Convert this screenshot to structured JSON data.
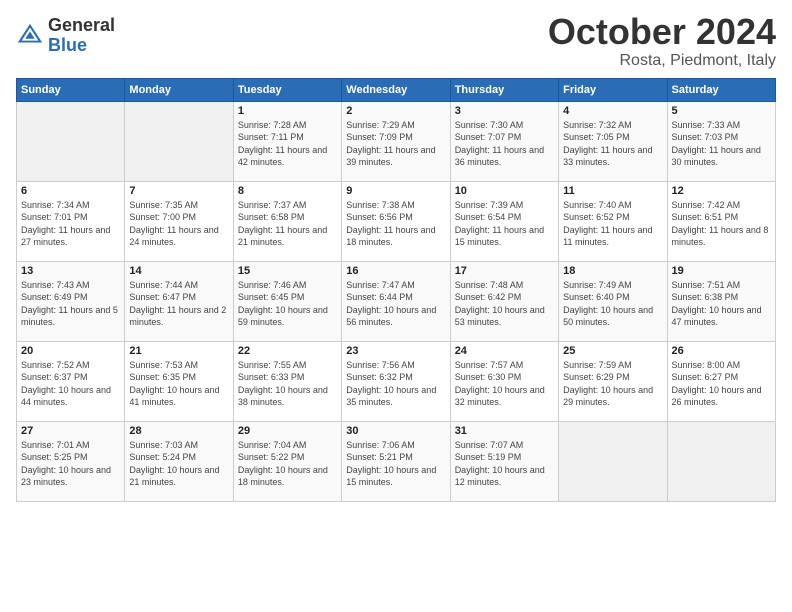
{
  "logo": {
    "general": "General",
    "blue": "Blue"
  },
  "title": "October 2024",
  "location": "Rosta, Piedmont, Italy",
  "days_of_week": [
    "Sunday",
    "Monday",
    "Tuesday",
    "Wednesday",
    "Thursday",
    "Friday",
    "Saturday"
  ],
  "weeks": [
    [
      {
        "day": "",
        "sunrise": "",
        "sunset": "",
        "daylight": ""
      },
      {
        "day": "",
        "sunrise": "",
        "sunset": "",
        "daylight": ""
      },
      {
        "day": "1",
        "sunrise": "Sunrise: 7:28 AM",
        "sunset": "Sunset: 7:11 PM",
        "daylight": "Daylight: 11 hours and 42 minutes."
      },
      {
        "day": "2",
        "sunrise": "Sunrise: 7:29 AM",
        "sunset": "Sunset: 7:09 PM",
        "daylight": "Daylight: 11 hours and 39 minutes."
      },
      {
        "day": "3",
        "sunrise": "Sunrise: 7:30 AM",
        "sunset": "Sunset: 7:07 PM",
        "daylight": "Daylight: 11 hours and 36 minutes."
      },
      {
        "day": "4",
        "sunrise": "Sunrise: 7:32 AM",
        "sunset": "Sunset: 7:05 PM",
        "daylight": "Daylight: 11 hours and 33 minutes."
      },
      {
        "day": "5",
        "sunrise": "Sunrise: 7:33 AM",
        "sunset": "Sunset: 7:03 PM",
        "daylight": "Daylight: 11 hours and 30 minutes."
      }
    ],
    [
      {
        "day": "6",
        "sunrise": "Sunrise: 7:34 AM",
        "sunset": "Sunset: 7:01 PM",
        "daylight": "Daylight: 11 hours and 27 minutes."
      },
      {
        "day": "7",
        "sunrise": "Sunrise: 7:35 AM",
        "sunset": "Sunset: 7:00 PM",
        "daylight": "Daylight: 11 hours and 24 minutes."
      },
      {
        "day": "8",
        "sunrise": "Sunrise: 7:37 AM",
        "sunset": "Sunset: 6:58 PM",
        "daylight": "Daylight: 11 hours and 21 minutes."
      },
      {
        "day": "9",
        "sunrise": "Sunrise: 7:38 AM",
        "sunset": "Sunset: 6:56 PM",
        "daylight": "Daylight: 11 hours and 18 minutes."
      },
      {
        "day": "10",
        "sunrise": "Sunrise: 7:39 AM",
        "sunset": "Sunset: 6:54 PM",
        "daylight": "Daylight: 11 hours and 15 minutes."
      },
      {
        "day": "11",
        "sunrise": "Sunrise: 7:40 AM",
        "sunset": "Sunset: 6:52 PM",
        "daylight": "Daylight: 11 hours and 11 minutes."
      },
      {
        "day": "12",
        "sunrise": "Sunrise: 7:42 AM",
        "sunset": "Sunset: 6:51 PM",
        "daylight": "Daylight: 11 hours and 8 minutes."
      }
    ],
    [
      {
        "day": "13",
        "sunrise": "Sunrise: 7:43 AM",
        "sunset": "Sunset: 6:49 PM",
        "daylight": "Daylight: 11 hours and 5 minutes."
      },
      {
        "day": "14",
        "sunrise": "Sunrise: 7:44 AM",
        "sunset": "Sunset: 6:47 PM",
        "daylight": "Daylight: 11 hours and 2 minutes."
      },
      {
        "day": "15",
        "sunrise": "Sunrise: 7:46 AM",
        "sunset": "Sunset: 6:45 PM",
        "daylight": "Daylight: 10 hours and 59 minutes."
      },
      {
        "day": "16",
        "sunrise": "Sunrise: 7:47 AM",
        "sunset": "Sunset: 6:44 PM",
        "daylight": "Daylight: 10 hours and 56 minutes."
      },
      {
        "day": "17",
        "sunrise": "Sunrise: 7:48 AM",
        "sunset": "Sunset: 6:42 PM",
        "daylight": "Daylight: 10 hours and 53 minutes."
      },
      {
        "day": "18",
        "sunrise": "Sunrise: 7:49 AM",
        "sunset": "Sunset: 6:40 PM",
        "daylight": "Daylight: 10 hours and 50 minutes."
      },
      {
        "day": "19",
        "sunrise": "Sunrise: 7:51 AM",
        "sunset": "Sunset: 6:38 PM",
        "daylight": "Daylight: 10 hours and 47 minutes."
      }
    ],
    [
      {
        "day": "20",
        "sunrise": "Sunrise: 7:52 AM",
        "sunset": "Sunset: 6:37 PM",
        "daylight": "Daylight: 10 hours and 44 minutes."
      },
      {
        "day": "21",
        "sunrise": "Sunrise: 7:53 AM",
        "sunset": "Sunset: 6:35 PM",
        "daylight": "Daylight: 10 hours and 41 minutes."
      },
      {
        "day": "22",
        "sunrise": "Sunrise: 7:55 AM",
        "sunset": "Sunset: 6:33 PM",
        "daylight": "Daylight: 10 hours and 38 minutes."
      },
      {
        "day": "23",
        "sunrise": "Sunrise: 7:56 AM",
        "sunset": "Sunset: 6:32 PM",
        "daylight": "Daylight: 10 hours and 35 minutes."
      },
      {
        "day": "24",
        "sunrise": "Sunrise: 7:57 AM",
        "sunset": "Sunset: 6:30 PM",
        "daylight": "Daylight: 10 hours and 32 minutes."
      },
      {
        "day": "25",
        "sunrise": "Sunrise: 7:59 AM",
        "sunset": "Sunset: 6:29 PM",
        "daylight": "Daylight: 10 hours and 29 minutes."
      },
      {
        "day": "26",
        "sunrise": "Sunrise: 8:00 AM",
        "sunset": "Sunset: 6:27 PM",
        "daylight": "Daylight: 10 hours and 26 minutes."
      }
    ],
    [
      {
        "day": "27",
        "sunrise": "Sunrise: 7:01 AM",
        "sunset": "Sunset: 5:25 PM",
        "daylight": "Daylight: 10 hours and 23 minutes."
      },
      {
        "day": "28",
        "sunrise": "Sunrise: 7:03 AM",
        "sunset": "Sunset: 5:24 PM",
        "daylight": "Daylight: 10 hours and 21 minutes."
      },
      {
        "day": "29",
        "sunrise": "Sunrise: 7:04 AM",
        "sunset": "Sunset: 5:22 PM",
        "daylight": "Daylight: 10 hours and 18 minutes."
      },
      {
        "day": "30",
        "sunrise": "Sunrise: 7:06 AM",
        "sunset": "Sunset: 5:21 PM",
        "daylight": "Daylight: 10 hours and 15 minutes."
      },
      {
        "day": "31",
        "sunrise": "Sunrise: 7:07 AM",
        "sunset": "Sunset: 5:19 PM",
        "daylight": "Daylight: 10 hours and 12 minutes."
      },
      {
        "day": "",
        "sunrise": "",
        "sunset": "",
        "daylight": ""
      },
      {
        "day": "",
        "sunrise": "",
        "sunset": "",
        "daylight": ""
      }
    ]
  ]
}
